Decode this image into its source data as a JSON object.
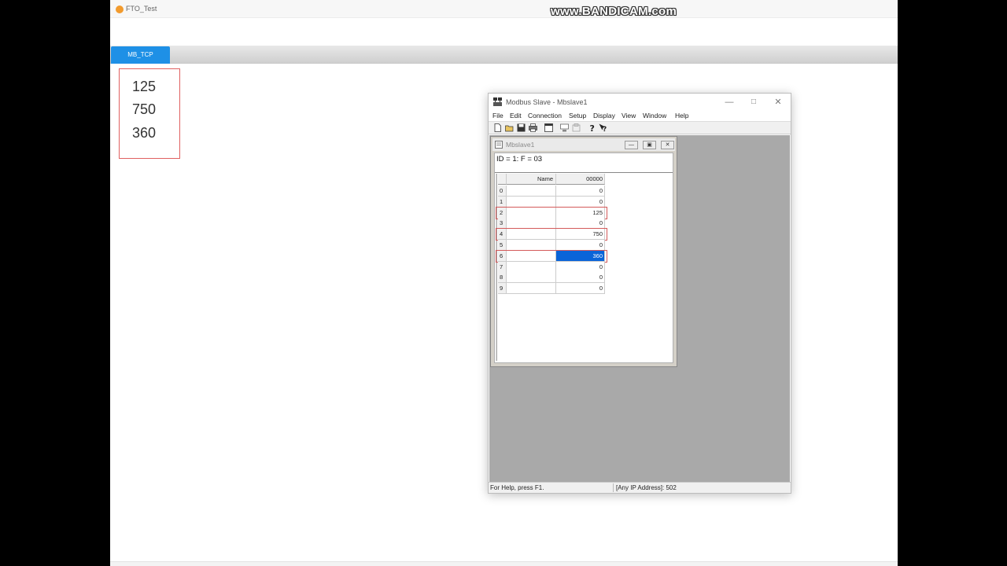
{
  "app": {
    "title": "FTO_Test",
    "watermark": "www.BANDICAM.com",
    "tabs": [
      {
        "label": "MB_TCP",
        "active": true
      }
    ],
    "values": [
      "125",
      "750",
      "360"
    ],
    "accent_color": "#1e90e6",
    "highlight_color": "#e06060"
  },
  "modbus": {
    "window_title": "Modbus Slave - Mbslave1",
    "menu": [
      "File",
      "Edit",
      "Connection",
      "Setup",
      "Display",
      "View",
      "Window",
      "Help"
    ],
    "toolbar": [
      "new-icon",
      "open-icon",
      "save-icon",
      "print-icon",
      "window-icon",
      "connect-icon",
      "disconnect-icon",
      "about-icon",
      "help-icon"
    ],
    "status": {
      "help": "For Help, press F1.",
      "address": "[Any IP Address]: 502"
    },
    "child": {
      "title": "Mbslave1",
      "info": "ID = 1: F = 03",
      "columns": {
        "name": "Name",
        "value": "00000"
      },
      "rows": [
        {
          "index": "0",
          "name": "",
          "value": "0"
        },
        {
          "index": "1",
          "name": "",
          "value": "0"
        },
        {
          "index": "2",
          "name": "",
          "value": "125",
          "highlighted": true
        },
        {
          "index": "3",
          "name": "",
          "value": "0"
        },
        {
          "index": "4",
          "name": "",
          "value": "750",
          "highlighted": true
        },
        {
          "index": "5",
          "name": "",
          "value": "0"
        },
        {
          "index": "6",
          "name": "",
          "value": "360",
          "highlighted": true,
          "selected": true
        },
        {
          "index": "7",
          "name": "",
          "value": "0"
        },
        {
          "index": "8",
          "name": "",
          "value": "0"
        },
        {
          "index": "9",
          "name": "",
          "value": "0"
        }
      ]
    }
  }
}
